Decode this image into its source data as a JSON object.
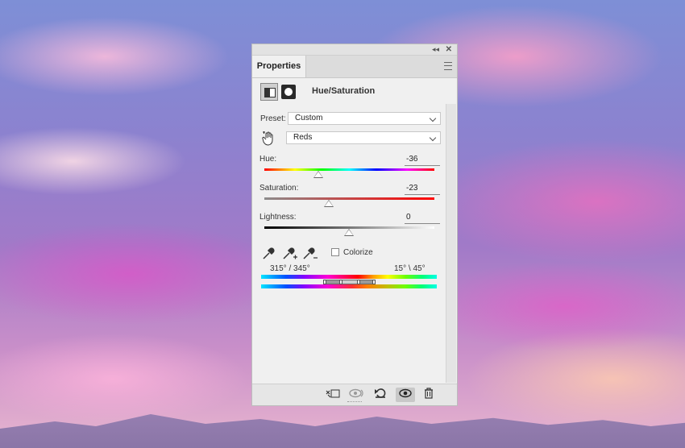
{
  "panel": {
    "tab_label": "Properties",
    "title": "Hue/Saturation",
    "preset_label": "Preset:",
    "preset_value": "Custom",
    "channel_value": "Reds",
    "hue": {
      "label": "Hue:",
      "value": "-36"
    },
    "saturation": {
      "label": "Saturation:",
      "value": "-23"
    },
    "lightness": {
      "label": "Lightness:",
      "value": "0"
    },
    "colorize_label": "Colorize",
    "range_left": "315° /  345°",
    "range_right": "15° \\  45°"
  },
  "icons": {
    "collapse": "double-chevron-left-icon",
    "close": "close-icon",
    "menu": "menu-icon",
    "adjustment": "adjustment-layer-icon",
    "mask": "layer-mask-icon",
    "target": "on-image-adjustment-hand-icon",
    "eyedropper": "eyedropper-icon",
    "eyedropper_add": "eyedropper-plus-icon",
    "eyedropper_sub": "eyedropper-minus-icon",
    "clip": "clip-to-layer-icon",
    "view_previous": "view-previous-state-icon",
    "reset": "reset-icon",
    "visibility": "eye-icon",
    "delete": "trash-icon"
  }
}
